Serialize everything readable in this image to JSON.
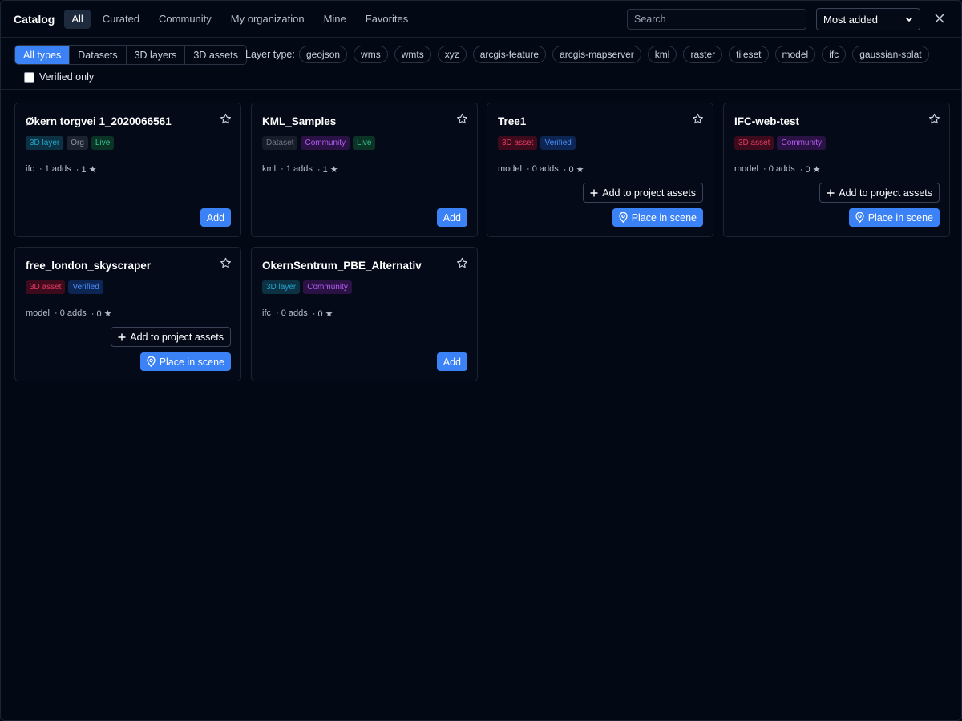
{
  "header": {
    "title": "Catalog",
    "tabs": [
      {
        "label": "All",
        "active": true
      },
      {
        "label": "Curated"
      },
      {
        "label": "Community"
      },
      {
        "label": "My organization"
      },
      {
        "label": "Mine"
      },
      {
        "label": "Favorites"
      }
    ],
    "search_placeholder": "Search",
    "sort_value": "Most added"
  },
  "filters": {
    "types": [
      {
        "label": "All types",
        "active": true
      },
      {
        "label": "Datasets"
      },
      {
        "label": "3D layers"
      },
      {
        "label": "3D assets"
      }
    ],
    "layer_type_label": "Layer type:",
    "layer_types": [
      "geojson",
      "wms",
      "wmts",
      "xyz",
      "arcgis-feature",
      "arcgis-mapserver",
      "kml",
      "raster",
      "tileset",
      "model",
      "ifc",
      "gaussian-splat"
    ],
    "verified_only_label": "Verified only"
  },
  "cards": [
    {
      "title": "Økern torgvei 1_2020066561",
      "badges": [
        "3D layer",
        "Org",
        "Live"
      ],
      "format": "ifc",
      "adds": "· 1 adds",
      "stars": "· 1 ★",
      "add_label": "Add"
    },
    {
      "title": "KML_Samples",
      "badges": [
        "Dataset",
        "Community",
        "Live"
      ],
      "format": "kml",
      "adds": "· 1 adds",
      "stars": "· 1 ★",
      "add_label": "Add"
    },
    {
      "title": "Tree1",
      "badges": [
        "3D asset",
        "Verified"
      ],
      "format": "model",
      "adds": "· 0 adds",
      "stars": "· 0 ★",
      "add_project_label": "Add to project assets",
      "place_label": "Place in scene"
    },
    {
      "title": "IFC-web-test",
      "badges": [
        "3D asset",
        "Community"
      ],
      "format": "model",
      "adds": "· 0 adds",
      "stars": "· 0 ★",
      "add_project_label": "Add to project assets",
      "place_label": "Place in scene"
    },
    {
      "title": "free_london_skyscraper",
      "badges": [
        "3D asset",
        "Verified"
      ],
      "format": "model",
      "adds": "· 0 adds",
      "stars": "· 0 ★",
      "add_project_label": "Add to project assets",
      "place_label": "Place in scene"
    },
    {
      "title": "OkernSentrum_PBE_Alternativ",
      "badges": [
        "3D layer",
        "Community"
      ],
      "format": "ifc",
      "adds": "· 0 adds",
      "stars": "· 0 ★",
      "add_label": "Add"
    }
  ]
}
